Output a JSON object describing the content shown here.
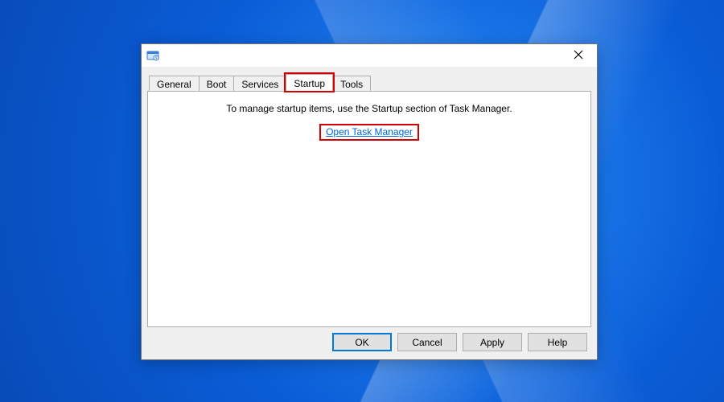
{
  "window": {
    "title": ""
  },
  "tabs": {
    "general": "General",
    "boot": "Boot",
    "services": "Services",
    "startup": "Startup",
    "tools": "Tools",
    "active": "startup"
  },
  "startup_tab": {
    "message": "To manage startup items, use the Startup section of Task Manager.",
    "link": "Open Task Manager"
  },
  "buttons": {
    "ok": "OK",
    "cancel": "Cancel",
    "apply": "Apply",
    "help": "Help"
  },
  "highlight": {
    "tab": "startup",
    "link": true
  }
}
